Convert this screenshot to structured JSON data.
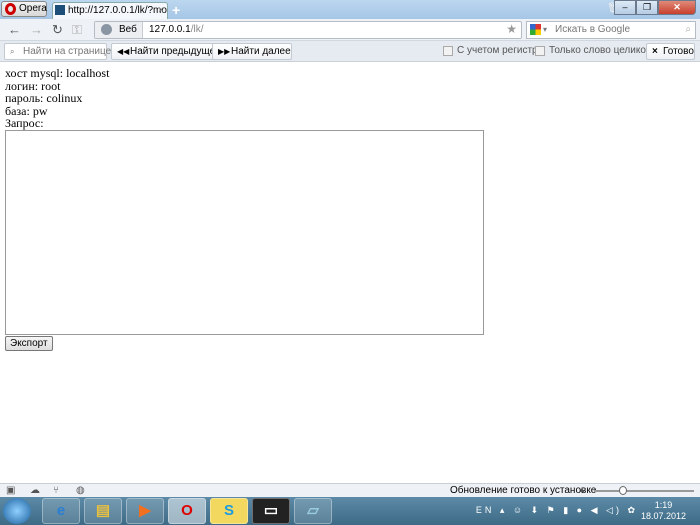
{
  "browser": {
    "menu_label": "Opera",
    "tab_title": "http://127.0.0.1/lk/?mo...",
    "address_mode": "Веб",
    "url_host": "127.0.0.1",
    "url_path": "/lk/",
    "search_placeholder": "Искать в Google"
  },
  "findbar": {
    "input_placeholder": "Найти на странице",
    "prev_label": "Найти предыдущее",
    "next_label": "Найти далее",
    "match_case_label": "С учетом регистра",
    "whole_word_label": "Только слово целиком",
    "done_label": "Готово"
  },
  "page": {
    "host_line": "хост mysql: localhost",
    "login_line": "логин: root",
    "password_line": "пароль: colinux",
    "db_line": "база: pw",
    "query_label": "Запрос:",
    "query_value": "",
    "export_label": "Экспорт"
  },
  "statusbar": {
    "update_text": "Обновление готово к установке",
    "zoom_level": 25
  },
  "taskbar": {
    "language": "EN",
    "time": "1:19",
    "date": "18.07.2012"
  }
}
